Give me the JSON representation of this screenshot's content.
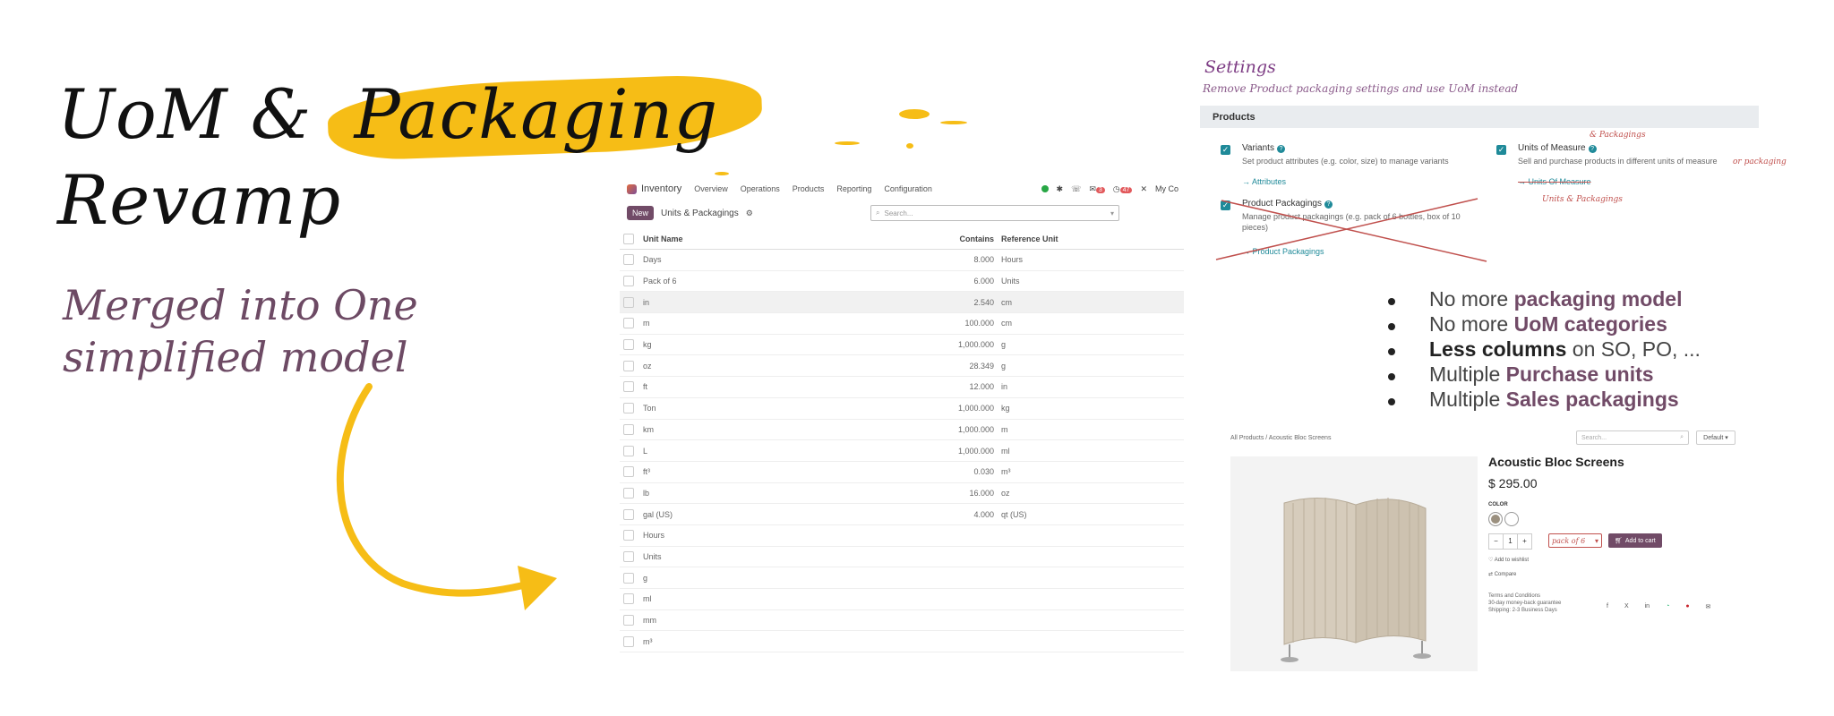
{
  "hero": {
    "title_line1_prefix": "UoM & ",
    "title_line1_highlight": "Packaging",
    "title_line2": "Revamp",
    "subtitle_line1": "Merged into One",
    "subtitle_line2": "simplified model"
  },
  "inventory": {
    "app_name": "Inventory",
    "menu": [
      "Overview",
      "Operations",
      "Products",
      "Reporting",
      "Configuration"
    ],
    "activity_badge": "3",
    "messages_badge": "47",
    "company": "My Co",
    "new_label": "New",
    "breadcrumb": "Units & Packagings",
    "search_placeholder": "Search...",
    "columns": {
      "name": "Unit Name",
      "contains": "Contains",
      "reference": "Reference Unit"
    },
    "rows": [
      {
        "name": "Days",
        "contains": "8.000",
        "ref": "Hours"
      },
      {
        "name": "Pack of 6",
        "contains": "6.000",
        "ref": "Units"
      },
      {
        "name": "in",
        "contains": "2.540",
        "ref": "cm"
      },
      {
        "name": "m",
        "contains": "100.000",
        "ref": "cm"
      },
      {
        "name": "kg",
        "contains": "1,000.000",
        "ref": "g"
      },
      {
        "name": "oz",
        "contains": "28.349",
        "ref": "g"
      },
      {
        "name": "ft",
        "contains": "12.000",
        "ref": "in"
      },
      {
        "name": "Ton",
        "contains": "1,000.000",
        "ref": "kg"
      },
      {
        "name": "km",
        "contains": "1,000.000",
        "ref": "m"
      },
      {
        "name": "L",
        "contains": "1,000.000",
        "ref": "ml"
      },
      {
        "name": "ft³",
        "contains": "0.030",
        "ref": "m³"
      },
      {
        "name": "lb",
        "contains": "16.000",
        "ref": "oz"
      },
      {
        "name": "gal (US)",
        "contains": "4.000",
        "ref": "qt (US)"
      },
      {
        "name": "Hours",
        "contains": "",
        "ref": ""
      },
      {
        "name": "Units",
        "contains": "",
        "ref": ""
      },
      {
        "name": "g",
        "contains": "",
        "ref": ""
      },
      {
        "name": "ml",
        "contains": "",
        "ref": ""
      },
      {
        "name": "mm",
        "contains": "",
        "ref": ""
      },
      {
        "name": "m³",
        "contains": "",
        "ref": ""
      }
    ]
  },
  "settings": {
    "title": "Settings",
    "note": "Remove Product packaging settings and use UoM instead",
    "section": "Products",
    "variants": {
      "name": "Variants",
      "desc": "Set product attributes (e.g. color, size) to manage variants",
      "link": "→ Attributes"
    },
    "uom": {
      "name": "Units of Measure",
      "desc": "Sell and purchase products in different units of measure",
      "link": "→ Units Of Measure",
      "anno_top": "& Packagings",
      "anno_right": "or packaging",
      "anno_link": "Units & Packagings"
    },
    "packagings": {
      "name": "Product Packagings",
      "desc_line1": "Manage product packagings (e.g. pack of 6 bottles, box of 10",
      "desc_line2": "pieces)",
      "link": "→ Product Packagings"
    }
  },
  "bullets": [
    {
      "pre": "No more ",
      "strong": "packaging model",
      "post": ""
    },
    {
      "pre": "No more ",
      "strong": "UoM categories",
      "post": ""
    },
    {
      "pre": "",
      "strong": "Less columns",
      "post": " on SO, PO, ..."
    },
    {
      "pre": "Multiple ",
      "strong": "Purchase units",
      "post": ""
    },
    {
      "pre": "Multiple ",
      "strong": "Sales packagings",
      "post": ""
    }
  ],
  "shop": {
    "breadcrumb": "All Products  /  Acoustic Bloc Screens",
    "search_placeholder": "Search...",
    "sort": "Default",
    "product_name": "Acoustic Bloc Screens",
    "price": "$ 295.00",
    "color_label": "COLOR",
    "qty": "1",
    "packaging": "pack of 6",
    "add_to_cart": "Add to cart",
    "wishlist": "Add to wishlist",
    "compare": "Compare",
    "terms_1": "Terms and Conditions",
    "terms_2": "30-day money-back guarantee",
    "terms_3": "Shipping: 2-3 Business Days"
  },
  "colors": {
    "accent": "#714b67",
    "highlight": "#f6bd16",
    "teal": "#1f8a99",
    "annotation": "#c0504d"
  }
}
